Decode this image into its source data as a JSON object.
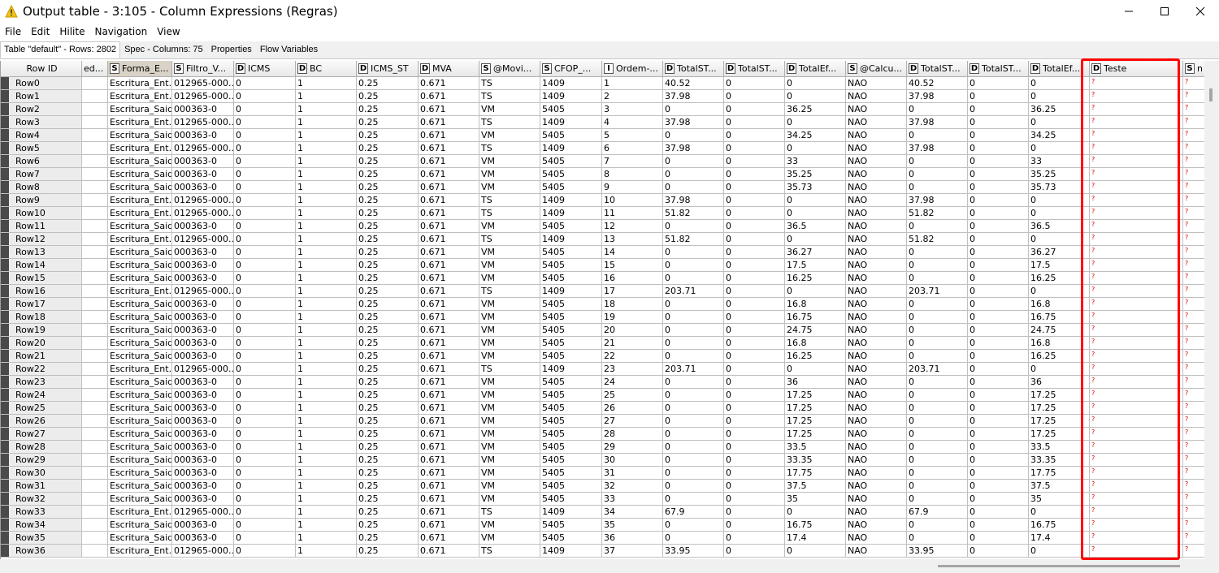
{
  "window": {
    "title": "Output table - 3:105 - Column Expressions (Regras)",
    "controls": [
      "minimize",
      "maximize",
      "close"
    ]
  },
  "menu": [
    "File",
    "Edit",
    "Hilite",
    "Navigation",
    "View"
  ],
  "tabs": [
    {
      "label": "Table \"default\" - Rows: 2802",
      "active": true
    },
    {
      "label": "Spec - Columns: 75",
      "active": false
    },
    {
      "label": "Properties",
      "active": false
    },
    {
      "label": "Flow Variables",
      "active": false
    }
  ],
  "highlight_color": "#ff0000",
  "missing_value_color": "#e00000",
  "table": {
    "rowid_header": "Row ID",
    "columns": [
      {
        "type": "",
        "name": "ed..."
      },
      {
        "type": "S",
        "name": "Forma_E..."
      },
      {
        "type": "S",
        "name": "Filtro_V..."
      },
      {
        "type": "D",
        "name": "ICMS"
      },
      {
        "type": "D",
        "name": "BC"
      },
      {
        "type": "D",
        "name": "ICMS_ST"
      },
      {
        "type": "D",
        "name": "MVA"
      },
      {
        "type": "S",
        "name": "@Movi..."
      },
      {
        "type": "S",
        "name": "CFOP_..."
      },
      {
        "type": "I",
        "name": "Ordem-..."
      },
      {
        "type": "D",
        "name": "TotalST..."
      },
      {
        "type": "D",
        "name": "TotalST..."
      },
      {
        "type": "D",
        "name": "TotalEf..."
      },
      {
        "type": "S",
        "name": "@Calcu..."
      },
      {
        "type": "D",
        "name": "TotalST..."
      },
      {
        "type": "D",
        "name": "TotalST..."
      },
      {
        "type": "D",
        "name": "TotalEf..."
      },
      {
        "type": "D",
        "name": "Teste"
      },
      {
        "type": "S",
        "name": "n"
      }
    ],
    "rows": [
      {
        "id": "Row0",
        "c": [
          "",
          "Escritura_Ent...",
          "012965-000...",
          "0",
          "1",
          "0.25",
          "0.671",
          "TS",
          "1409",
          "1",
          "40.52",
          "0",
          "0",
          "NAO",
          "40.52",
          "0",
          "0",
          "?",
          "?"
        ]
      },
      {
        "id": "Row1",
        "c": [
          "",
          "Escritura_Ent...",
          "012965-000...",
          "0",
          "1",
          "0.25",
          "0.671",
          "TS",
          "1409",
          "2",
          "37.98",
          "0",
          "0",
          "NAO",
          "37.98",
          "0",
          "0",
          "?",
          "?"
        ]
      },
      {
        "id": "Row2",
        "c": [
          "",
          "Escritura_Saida",
          "000363-0",
          "0",
          "1",
          "0.25",
          "0.671",
          "VM",
          "5405",
          "3",
          "0",
          "0",
          "36.25",
          "NAO",
          "0",
          "0",
          "36.25",
          "?",
          "?"
        ]
      },
      {
        "id": "Row3",
        "c": [
          "",
          "Escritura_Ent...",
          "012965-000...",
          "0",
          "1",
          "0.25",
          "0.671",
          "TS",
          "1409",
          "4",
          "37.98",
          "0",
          "0",
          "NAO",
          "37.98",
          "0",
          "0",
          "?",
          "?"
        ]
      },
      {
        "id": "Row4",
        "c": [
          "",
          "Escritura_Saida",
          "000363-0",
          "0",
          "1",
          "0.25",
          "0.671",
          "VM",
          "5405",
          "5",
          "0",
          "0",
          "34.25",
          "NAO",
          "0",
          "0",
          "34.25",
          "?",
          "?"
        ]
      },
      {
        "id": "Row5",
        "c": [
          "",
          "Escritura_Ent...",
          "012965-000...",
          "0",
          "1",
          "0.25",
          "0.671",
          "TS",
          "1409",
          "6",
          "37.98",
          "0",
          "0",
          "NAO",
          "37.98",
          "0",
          "0",
          "?",
          "?"
        ]
      },
      {
        "id": "Row6",
        "c": [
          "",
          "Escritura_Saida",
          "000363-0",
          "0",
          "1",
          "0.25",
          "0.671",
          "VM",
          "5405",
          "7",
          "0",
          "0",
          "33",
          "NAO",
          "0",
          "0",
          "33",
          "?",
          "?"
        ]
      },
      {
        "id": "Row7",
        "c": [
          "",
          "Escritura_Saida",
          "000363-0",
          "0",
          "1",
          "0.25",
          "0.671",
          "VM",
          "5405",
          "8",
          "0",
          "0",
          "35.25",
          "NAO",
          "0",
          "0",
          "35.25",
          "?",
          "?"
        ]
      },
      {
        "id": "Row8",
        "c": [
          "",
          "Escritura_Saida",
          "000363-0",
          "0",
          "1",
          "0.25",
          "0.671",
          "VM",
          "5405",
          "9",
          "0",
          "0",
          "35.73",
          "NAO",
          "0",
          "0",
          "35.73",
          "?",
          "?"
        ]
      },
      {
        "id": "Row9",
        "c": [
          "",
          "Escritura_Ent...",
          "012965-000...",
          "0",
          "1",
          "0.25",
          "0.671",
          "TS",
          "1409",
          "10",
          "37.98",
          "0",
          "0",
          "NAO",
          "37.98",
          "0",
          "0",
          "?",
          "?"
        ]
      },
      {
        "id": "Row10",
        "c": [
          "",
          "Escritura_Ent...",
          "012965-000...",
          "0",
          "1",
          "0.25",
          "0.671",
          "TS",
          "1409",
          "11",
          "51.82",
          "0",
          "0",
          "NAO",
          "51.82",
          "0",
          "0",
          "?",
          "?"
        ]
      },
      {
        "id": "Row11",
        "c": [
          "",
          "Escritura_Saida",
          "000363-0",
          "0",
          "1",
          "0.25",
          "0.671",
          "VM",
          "5405",
          "12",
          "0",
          "0",
          "36.5",
          "NAO",
          "0",
          "0",
          "36.5",
          "?",
          "?"
        ]
      },
      {
        "id": "Row12",
        "c": [
          "",
          "Escritura_Ent...",
          "012965-000...",
          "0",
          "1",
          "0.25",
          "0.671",
          "TS",
          "1409",
          "13",
          "51.82",
          "0",
          "0",
          "NAO",
          "51.82",
          "0",
          "0",
          "?",
          "?"
        ]
      },
      {
        "id": "Row13",
        "c": [
          "",
          "Escritura_Saida",
          "000363-0",
          "0",
          "1",
          "0.25",
          "0.671",
          "VM",
          "5405",
          "14",
          "0",
          "0",
          "36.27",
          "NAO",
          "0",
          "0",
          "36.27",
          "?",
          "?"
        ]
      },
      {
        "id": "Row14",
        "c": [
          "",
          "Escritura_Saida",
          "000363-0",
          "0",
          "1",
          "0.25",
          "0.671",
          "VM",
          "5405",
          "15",
          "0",
          "0",
          "17.5",
          "NAO",
          "0",
          "0",
          "17.5",
          "?",
          "?"
        ]
      },
      {
        "id": "Row15",
        "c": [
          "",
          "Escritura_Saida",
          "000363-0",
          "0",
          "1",
          "0.25",
          "0.671",
          "VM",
          "5405",
          "16",
          "0",
          "0",
          "16.25",
          "NAO",
          "0",
          "0",
          "16.25",
          "?",
          "?"
        ]
      },
      {
        "id": "Row16",
        "c": [
          "",
          "Escritura_Ent...",
          "012965-000...",
          "0",
          "1",
          "0.25",
          "0.671",
          "TS",
          "1409",
          "17",
          "203.71",
          "0",
          "0",
          "NAO",
          "203.71",
          "0",
          "0",
          "?",
          "?"
        ]
      },
      {
        "id": "Row17",
        "c": [
          "",
          "Escritura_Saida",
          "000363-0",
          "0",
          "1",
          "0.25",
          "0.671",
          "VM",
          "5405",
          "18",
          "0",
          "0",
          "16.8",
          "NAO",
          "0",
          "0",
          "16.8",
          "?",
          "?"
        ]
      },
      {
        "id": "Row18",
        "c": [
          "",
          "Escritura_Saida",
          "000363-0",
          "0",
          "1",
          "0.25",
          "0.671",
          "VM",
          "5405",
          "19",
          "0",
          "0",
          "16.75",
          "NAO",
          "0",
          "0",
          "16.75",
          "?",
          "?"
        ]
      },
      {
        "id": "Row19",
        "c": [
          "",
          "Escritura_Saida",
          "000363-0",
          "0",
          "1",
          "0.25",
          "0.671",
          "VM",
          "5405",
          "20",
          "0",
          "0",
          "24.75",
          "NAO",
          "0",
          "0",
          "24.75",
          "?",
          "?"
        ]
      },
      {
        "id": "Row20",
        "c": [
          "",
          "Escritura_Saida",
          "000363-0",
          "0",
          "1",
          "0.25",
          "0.671",
          "VM",
          "5405",
          "21",
          "0",
          "0",
          "16.8",
          "NAO",
          "0",
          "0",
          "16.8",
          "?",
          "?"
        ]
      },
      {
        "id": "Row21",
        "c": [
          "",
          "Escritura_Saida",
          "000363-0",
          "0",
          "1",
          "0.25",
          "0.671",
          "VM",
          "5405",
          "22",
          "0",
          "0",
          "16.25",
          "NAO",
          "0",
          "0",
          "16.25",
          "?",
          "?"
        ]
      },
      {
        "id": "Row22",
        "c": [
          "",
          "Escritura_Ent...",
          "012965-000...",
          "0",
          "1",
          "0.25",
          "0.671",
          "TS",
          "1409",
          "23",
          "203.71",
          "0",
          "0",
          "NAO",
          "203.71",
          "0",
          "0",
          "?",
          "?"
        ]
      },
      {
        "id": "Row23",
        "c": [
          "",
          "Escritura_Saida",
          "000363-0",
          "0",
          "1",
          "0.25",
          "0.671",
          "VM",
          "5405",
          "24",
          "0",
          "0",
          "36",
          "NAO",
          "0",
          "0",
          "36",
          "?",
          "?"
        ]
      },
      {
        "id": "Row24",
        "c": [
          "",
          "Escritura_Saida",
          "000363-0",
          "0",
          "1",
          "0.25",
          "0.671",
          "VM",
          "5405",
          "25",
          "0",
          "0",
          "17.25",
          "NAO",
          "0",
          "0",
          "17.25",
          "?",
          "?"
        ]
      },
      {
        "id": "Row25",
        "c": [
          "",
          "Escritura_Saida",
          "000363-0",
          "0",
          "1",
          "0.25",
          "0.671",
          "VM",
          "5405",
          "26",
          "0",
          "0",
          "17.25",
          "NAO",
          "0",
          "0",
          "17.25",
          "?",
          "?"
        ]
      },
      {
        "id": "Row26",
        "c": [
          "",
          "Escritura_Saida",
          "000363-0",
          "0",
          "1",
          "0.25",
          "0.671",
          "VM",
          "5405",
          "27",
          "0",
          "0",
          "17.25",
          "NAO",
          "0",
          "0",
          "17.25",
          "?",
          "?"
        ]
      },
      {
        "id": "Row27",
        "c": [
          "",
          "Escritura_Saida",
          "000363-0",
          "0",
          "1",
          "0.25",
          "0.671",
          "VM",
          "5405",
          "28",
          "0",
          "0",
          "17.25",
          "NAO",
          "0",
          "0",
          "17.25",
          "?",
          "?"
        ]
      },
      {
        "id": "Row28",
        "c": [
          "",
          "Escritura_Saida",
          "000363-0",
          "0",
          "1",
          "0.25",
          "0.671",
          "VM",
          "5405",
          "29",
          "0",
          "0",
          "33.5",
          "NAO",
          "0",
          "0",
          "33.5",
          "?",
          "?"
        ]
      },
      {
        "id": "Row29",
        "c": [
          "",
          "Escritura_Saida",
          "000363-0",
          "0",
          "1",
          "0.25",
          "0.671",
          "VM",
          "5405",
          "30",
          "0",
          "0",
          "33.35",
          "NAO",
          "0",
          "0",
          "33.35",
          "?",
          "?"
        ]
      },
      {
        "id": "Row30",
        "c": [
          "",
          "Escritura_Saida",
          "000363-0",
          "0",
          "1",
          "0.25",
          "0.671",
          "VM",
          "5405",
          "31",
          "0",
          "0",
          "17.75",
          "NAO",
          "0",
          "0",
          "17.75",
          "?",
          "?"
        ]
      },
      {
        "id": "Row31",
        "c": [
          "",
          "Escritura_Saida",
          "000363-0",
          "0",
          "1",
          "0.25",
          "0.671",
          "VM",
          "5405",
          "32",
          "0",
          "0",
          "37.5",
          "NAO",
          "0",
          "0",
          "37.5",
          "?",
          "?"
        ]
      },
      {
        "id": "Row32",
        "c": [
          "",
          "Escritura_Saida",
          "000363-0",
          "0",
          "1",
          "0.25",
          "0.671",
          "VM",
          "5405",
          "33",
          "0",
          "0",
          "35",
          "NAO",
          "0",
          "0",
          "35",
          "?",
          "?"
        ]
      },
      {
        "id": "Row33",
        "c": [
          "",
          "Escritura_Ent...",
          "012965-000...",
          "0",
          "1",
          "0.25",
          "0.671",
          "TS",
          "1409",
          "34",
          "67.9",
          "0",
          "0",
          "NAO",
          "67.9",
          "0",
          "0",
          "?",
          "?"
        ]
      },
      {
        "id": "Row34",
        "c": [
          "",
          "Escritura_Saida",
          "000363-0",
          "0",
          "1",
          "0.25",
          "0.671",
          "VM",
          "5405",
          "35",
          "0",
          "0",
          "16.75",
          "NAO",
          "0",
          "0",
          "16.75",
          "?",
          "?"
        ]
      },
      {
        "id": "Row35",
        "c": [
          "",
          "Escritura_Saida",
          "000363-0",
          "0",
          "1",
          "0.25",
          "0.671",
          "VM",
          "5405",
          "36",
          "0",
          "0",
          "17.4",
          "NAO",
          "0",
          "0",
          "17.4",
          "?",
          "?"
        ]
      },
      {
        "id": "Row36",
        "c": [
          "",
          "Escritura_Ent...",
          "012965-000...",
          "0",
          "1",
          "0.25",
          "0.671",
          "TS",
          "1409",
          "37",
          "33.95",
          "0",
          "0",
          "NAO",
          "33.95",
          "0",
          "0",
          "?",
          "?"
        ]
      }
    ]
  }
}
